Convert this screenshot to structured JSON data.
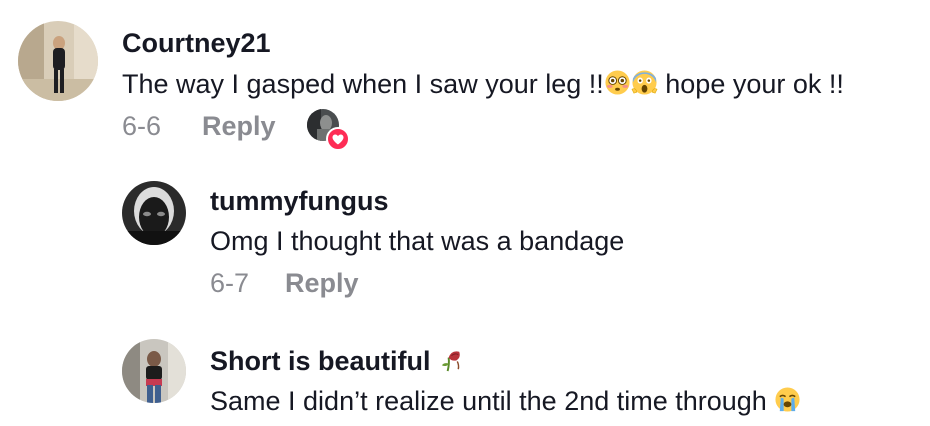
{
  "comments": [
    {
      "username": "Courtney21",
      "text_before": "The way I gasped when I saw your leg !!",
      "emojis": [
        "flushed-face-emoji",
        "screaming-face-emoji"
      ],
      "text_after": " hope your ok !!",
      "date": "6-6",
      "reply_label": "Reply",
      "creator_liked": true
    },
    {
      "username": "tummyfungus",
      "text": "Omg I thought that was a bandage",
      "date": "6-7",
      "reply_label": "Reply"
    },
    {
      "username": "Short is beautiful",
      "username_emoji": "wilted-rose-emoji",
      "text": "Same I didn’t realize until the 2nd time through",
      "text_emoji": "loudly-crying-face-emoji"
    }
  ],
  "colors": {
    "text": "#161823",
    "muted": "#8a8b91",
    "like_badge": "#fe2c55"
  }
}
